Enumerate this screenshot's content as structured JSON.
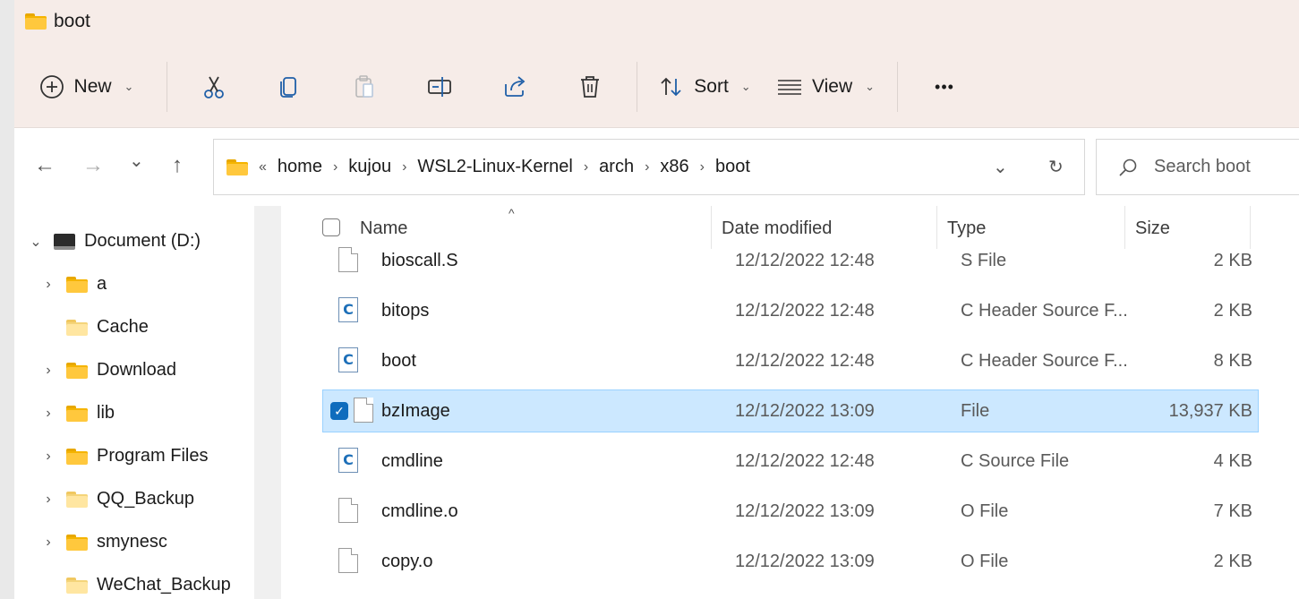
{
  "window": {
    "title": "boot"
  },
  "toolbar": {
    "new_label": "New",
    "sort_label": "Sort",
    "view_label": "View",
    "more_label": "•••"
  },
  "nav": {
    "back": "←",
    "forward": "→",
    "recent": "⌄",
    "up": "↑",
    "overflow": "«",
    "breadcrumbs": [
      "home",
      "kujou",
      "WSL2-Linux-Kernel",
      "arch",
      "x86",
      "boot"
    ],
    "search_placeholder": "Search boot"
  },
  "sidebar": {
    "items": [
      {
        "label": "Document (D:)",
        "type": "drive",
        "expanded": true
      },
      {
        "label": "a",
        "type": "folder",
        "has_children": true
      },
      {
        "label": "Cache",
        "type": "folder",
        "has_children": false
      },
      {
        "label": "Download",
        "type": "folder",
        "has_children": true
      },
      {
        "label": "lib",
        "type": "folder",
        "has_children": true
      },
      {
        "label": "Program Files",
        "type": "folder",
        "has_children": true
      },
      {
        "label": "QQ_Backup",
        "type": "folder",
        "has_children": true
      },
      {
        "label": "smynesc",
        "type": "folder",
        "has_children": true
      },
      {
        "label": "WeChat_Backup",
        "type": "folder",
        "has_children": false
      }
    ]
  },
  "list": {
    "columns": [
      "Name",
      "Date modified",
      "Type",
      "Size"
    ],
    "rows": [
      {
        "name": "bioscall.S",
        "date": "12/12/2022 12:48",
        "type": "S File",
        "size": "2 KB",
        "icon": "file-icon",
        "selected": false
      },
      {
        "name": "bitops",
        "date": "12/12/2022 12:48",
        "type": "C Header Source F...",
        "size": "2 KB",
        "icon": "c-file-icon",
        "selected": false
      },
      {
        "name": "boot",
        "date": "12/12/2022 12:48",
        "type": "C Header Source F...",
        "size": "8 KB",
        "icon": "c-file-icon",
        "selected": false
      },
      {
        "name": "bzImage",
        "date": "12/12/2022 13:09",
        "type": "File",
        "size": "13,937 KB",
        "icon": "file-icon",
        "selected": true
      },
      {
        "name": "cmdline",
        "date": "12/12/2022 12:48",
        "type": "C Source File",
        "size": "4 KB",
        "icon": "c-file-icon",
        "selected": false
      },
      {
        "name": "cmdline.o",
        "date": "12/12/2022 13:09",
        "type": "O File",
        "size": "7 KB",
        "icon": "file-icon",
        "selected": false
      },
      {
        "name": "copy.o",
        "date": "12/12/2022 13:09",
        "type": "O File",
        "size": "2 KB",
        "icon": "file-icon",
        "selected": false
      }
    ]
  },
  "colors": {
    "accent": "#0f6cbd",
    "selection": "#cce8ff",
    "titlebar": "#f6ece8"
  }
}
